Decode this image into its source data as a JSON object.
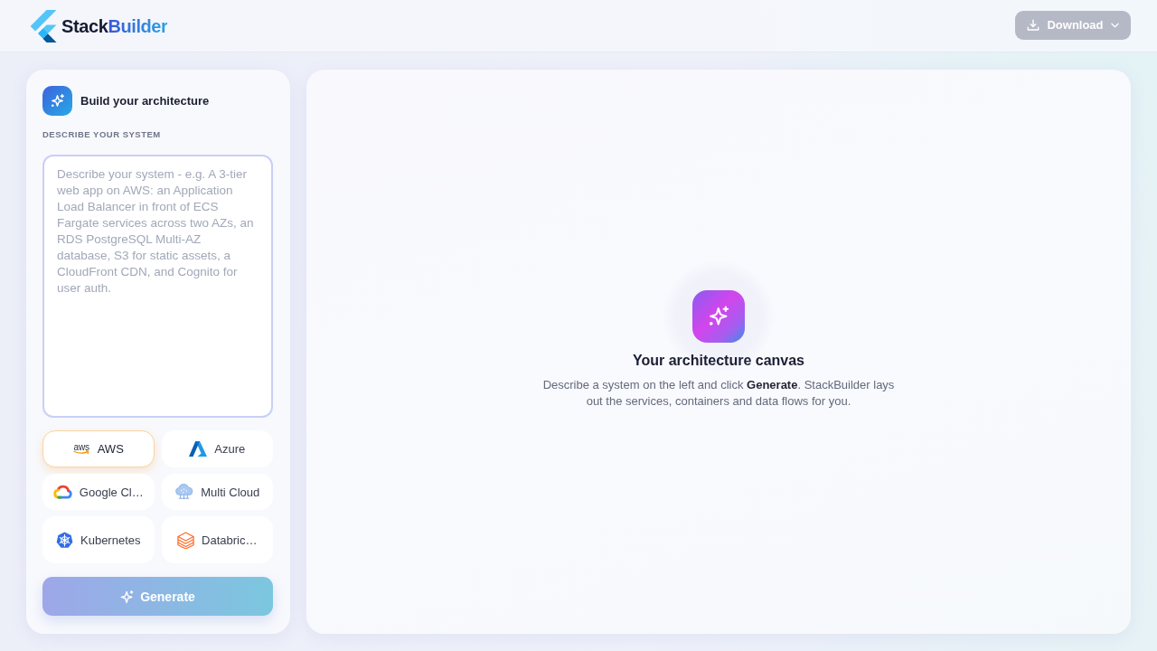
{
  "header": {
    "brand": {
      "name": "Stack",
      "accent": "Builder"
    },
    "download": {
      "label": "Download",
      "disabled": true
    }
  },
  "sidebar": {
    "title": "Build your architecture",
    "section_label": "DESCRIBE YOUR SYSTEM",
    "description": {
      "placeholder": "Describe your system - e.g. A 3-tier web app on AWS: an Application Load Balancer in front of ECS Fargate services across two AZs, an RDS PostgreSQL Multi-AZ database, S3 for static assets, a CloudFront CDN, and Cognito for user auth."
    },
    "providers": [
      {
        "name": "AWS",
        "kind": "aws",
        "logo_text": "aws",
        "selected": true
      },
      {
        "name": "Azure",
        "kind": "azure",
        "selected": false
      },
      {
        "name": "Google Cl…",
        "kind": "gcp",
        "selected": false
      },
      {
        "name": "Multi Cloud",
        "kind": "multicloud",
        "selected": false
      },
      {
        "name": "Kubernetes",
        "kind": "kubernetes",
        "selected": false
      },
      {
        "name": "Databric…",
        "kind": "databricks",
        "selected": false
      }
    ],
    "generate": {
      "label": "Generate",
      "disabled": true
    }
  },
  "canvas": {
    "title": "Your architecture canvas",
    "description": "Describe a system on the left and click **Generate**. StackBuilder lays out the services, containers and data flows for you."
  }
}
